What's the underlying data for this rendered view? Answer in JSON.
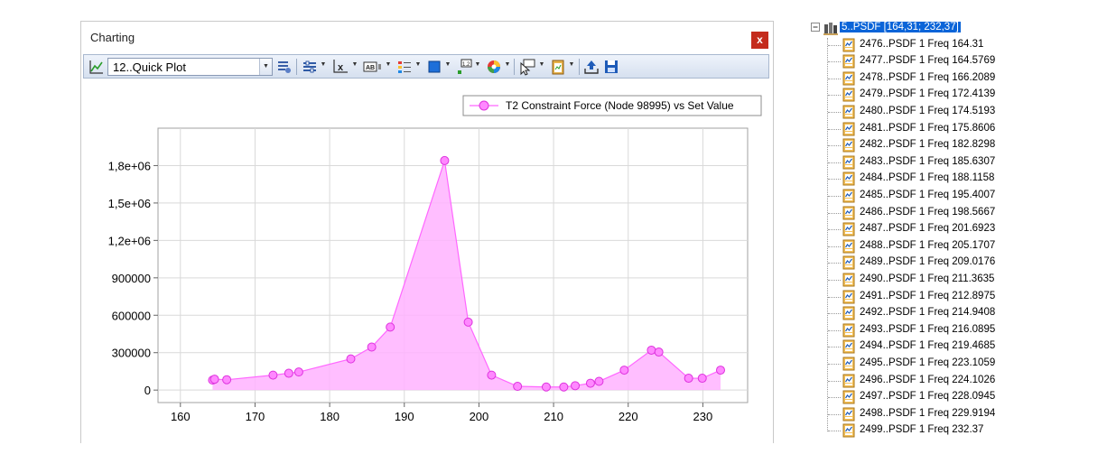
{
  "window": {
    "title": "Charting",
    "close_glyph": "x",
    "close_color": "#c42b1c"
  },
  "toolbar": {
    "plot_select_value": "12..Quick Plot",
    "icons": [
      "line-chart-icon",
      "table-settings-icon",
      "series-settings-icon",
      "axis-x-icon",
      "label-icon",
      "legend-icon",
      "fill-color-icon",
      "data-label-icon",
      "color-wheel-icon",
      "cursor-icon",
      "clipboard-icon",
      "export-icon",
      "save-icon"
    ]
  },
  "chart_data": {
    "type": "area",
    "title": "",
    "xlabel": "",
    "ylabel": "",
    "xlim": [
      157,
      236
    ],
    "ylim": [
      -100000,
      2100000
    ],
    "x_ticks": [
      "160",
      "170",
      "180",
      "190",
      "200",
      "210",
      "220",
      "230"
    ],
    "y_ticks": [
      "0",
      "300000",
      "600000",
      "900000",
      "1,2e+06",
      "1,5e+06",
      "1,8e+06"
    ],
    "grid": true,
    "legend_position": "top-right",
    "colors": {
      "series": "#ff66ff",
      "fill": "#ffb3ff",
      "marker": "#ff88ff"
    },
    "series": [
      {
        "name": "T2 Constraint Force (Node 98995) vs Set Value",
        "x": [
          164.31,
          164.5769,
          166.2089,
          172.4139,
          174.5193,
          175.8606,
          182.8298,
          185.6307,
          188.1158,
          195.4007,
          198.5667,
          201.6923,
          205.1707,
          209.0176,
          211.3635,
          212.8975,
          214.9408,
          216.0895,
          219.4685,
          223.1059,
          224.1026,
          228.0945,
          229.9194,
          232.37
        ],
        "values": [
          80000,
          87000,
          83000,
          120000,
          135000,
          145000,
          250000,
          345000,
          505000,
          1840000,
          545000,
          120000,
          30000,
          25000,
          25000,
          35000,
          55000,
          70000,
          160000,
          320000,
          305000,
          95000,
          95000,
          160000
        ]
      }
    ]
  },
  "tree": {
    "root_label": "5..PSDF [164,31; 232,37]",
    "items": [
      "2476..PSDF 1 Freq 164.31",
      "2477..PSDF 1 Freq 164.5769",
      "2478..PSDF 1 Freq 166.2089",
      "2479..PSDF 1 Freq 172.4139",
      "2480..PSDF 1 Freq 174.5193",
      "2481..PSDF 1 Freq 175.8606",
      "2482..PSDF 1 Freq 182.8298",
      "2483..PSDF 1 Freq 185.6307",
      "2484..PSDF 1 Freq 188.1158",
      "2485..PSDF 1 Freq 195.4007",
      "2486..PSDF 1 Freq 198.5667",
      "2487..PSDF 1 Freq 201.6923",
      "2488..PSDF 1 Freq 205.1707",
      "2489..PSDF 1 Freq 209.0176",
      "2490..PSDF 1 Freq 211.3635",
      "2491..PSDF 1 Freq 212.8975",
      "2492..PSDF 1 Freq 214.9408",
      "2493..PSDF 1 Freq 216.0895",
      "2494..PSDF 1 Freq 219.4685",
      "2495..PSDF 1 Freq 223.1059",
      "2496..PSDF 1 Freq 224.1026",
      "2497..PSDF 1 Freq 228.0945",
      "2498..PSDF 1 Freq 229.9194",
      "2499..PSDF 1 Freq 232.37"
    ],
    "selection_color": "#0a64d8"
  }
}
